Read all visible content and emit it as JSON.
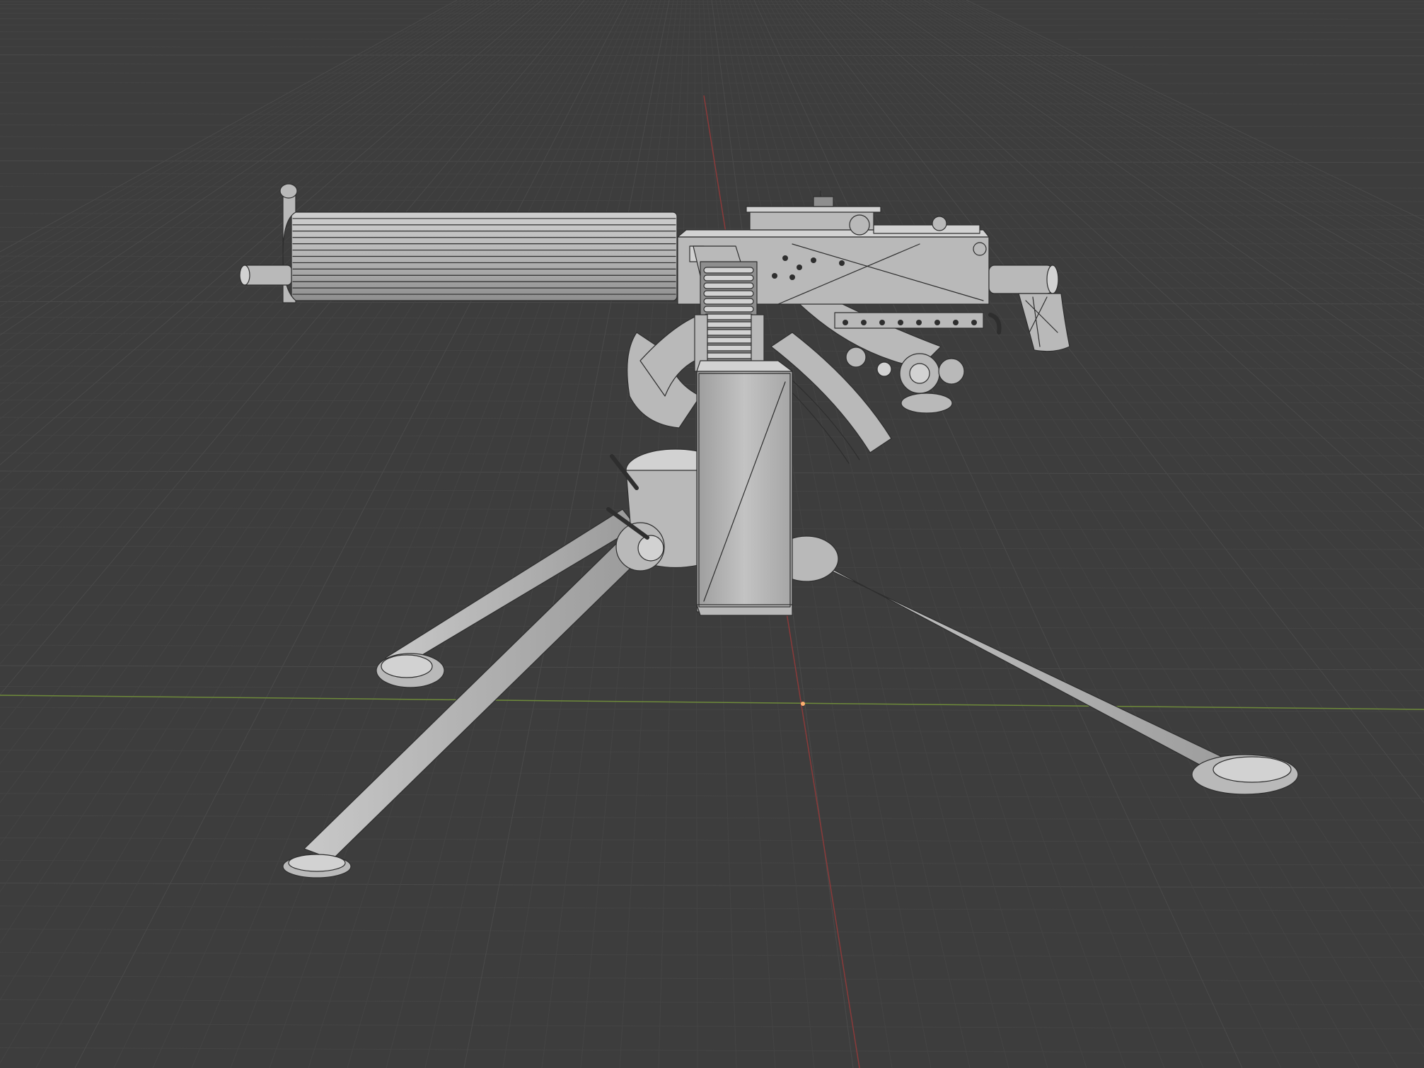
{
  "viewport": {
    "background_color": "#3d3d3d",
    "grid_color": "#4a4a4a",
    "grid_fine_color": "#444444",
    "x_axis_color": "#8a3a3a",
    "y_axis_color": "#6e8a3a",
    "origin_color": "#ffb070",
    "view_mode": "solid-wireframe",
    "object": {
      "mesh_fill": "#b9b9b9",
      "mesh_shadow": "#8e8e8e",
      "mesh_highlight": "#d2d2d2",
      "wire_color": "#2e2e2e"
    }
  }
}
